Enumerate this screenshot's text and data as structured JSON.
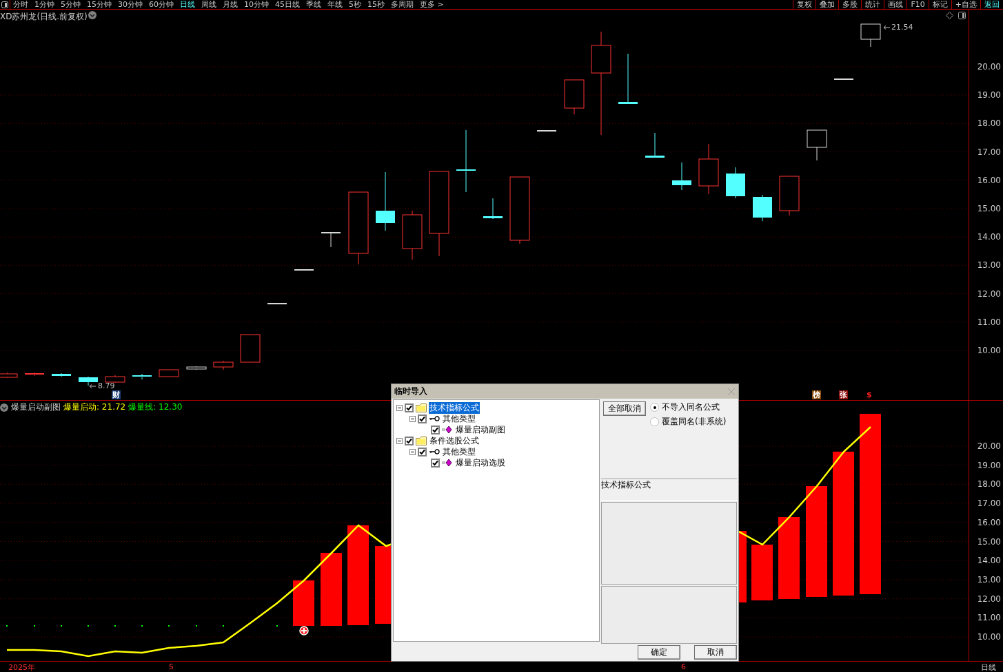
{
  "top_bar": {
    "periods": [
      {
        "label": "分时",
        "selected": false
      },
      {
        "label": "1分钟",
        "selected": false
      },
      {
        "label": "5分钟",
        "selected": false
      },
      {
        "label": "15分钟",
        "selected": false
      },
      {
        "label": "30分钟",
        "selected": false
      },
      {
        "label": "60分钟",
        "selected": false
      },
      {
        "label": "日线",
        "selected": true
      },
      {
        "label": "周线",
        "selected": false
      },
      {
        "label": "月线",
        "selected": false
      },
      {
        "label": "10分钟",
        "selected": false
      },
      {
        "label": "45日线",
        "selected": false
      },
      {
        "label": "季线",
        "selected": false
      },
      {
        "label": "年线",
        "selected": false
      },
      {
        "label": "5秒",
        "selected": false
      },
      {
        "label": "15秒",
        "selected": false
      },
      {
        "label": "多周期",
        "selected": false
      },
      {
        "label": "更多 >",
        "selected": false
      }
    ],
    "tools": [
      {
        "label": "复权",
        "selected": false
      },
      {
        "label": "叠加",
        "selected": false
      },
      {
        "label": "多股",
        "selected": false
      },
      {
        "label": "统计",
        "selected": false
      },
      {
        "label": "画线",
        "selected": false
      },
      {
        "label": "F10",
        "selected": false
      },
      {
        "label": "标记",
        "selected": false
      },
      {
        "label": "+自选",
        "selected": false
      },
      {
        "label": "返回",
        "selected": true
      }
    ]
  },
  "main_chart": {
    "title": "XD苏州龙(日线.前复权)",
    "low_label": "8.79",
    "high_label": "21.54",
    "markers": [
      {
        "label": "财",
        "kind": "tag",
        "color": "#1c3f78"
      },
      {
        "label": "榜",
        "kind": "tag",
        "color": "#8a4a08"
      },
      {
        "label": "张",
        "kind": "tag",
        "color": "#8a0a0a"
      },
      {
        "label": "$",
        "kind": "glyph",
        "color": "#ff2020"
      }
    ],
    "axis": [
      "20.00",
      "19.00",
      "18.00",
      "17.00",
      "16.00",
      "15.00",
      "14.00",
      "13.00",
      "12.00",
      "11.00",
      "10.00"
    ]
  },
  "sub_chart": {
    "title": "爆量启动副图",
    "legend": [
      {
        "label": "爆量启动: 21.72",
        "color": "#ffff00"
      },
      {
        "label": "爆量线: 12.30",
        "color": "#00ff00"
      }
    ],
    "axis": [
      "20.00",
      "19.00",
      "18.00",
      "17.00",
      "16.00",
      "15.00",
      "14.00",
      "13.00",
      "12.00",
      "11.00",
      "10.00"
    ]
  },
  "time_axis": {
    "labels": [
      "2025年",
      "5",
      "6"
    ],
    "period": "日线"
  },
  "dialog": {
    "title": "临时导入",
    "tree": [
      {
        "label": "技术指标公式",
        "kind": "folder",
        "checked": true,
        "expanded": true,
        "selected": true,
        "children": [
          {
            "label": "其他类型",
            "kind": "type",
            "checked": true,
            "expanded": true,
            "selected": false,
            "children": [
              {
                "label": "爆量启动副图",
                "kind": "formula",
                "checked": true,
                "selected": false
              }
            ]
          }
        ]
      },
      {
        "label": "条件选股公式",
        "kind": "folder",
        "checked": true,
        "expanded": true,
        "selected": false,
        "children": [
          {
            "label": "其他类型",
            "kind": "type",
            "checked": true,
            "expanded": true,
            "selected": false,
            "children": [
              {
                "label": "爆量启动选股",
                "kind": "formula",
                "checked": true,
                "selected": false
              }
            ]
          }
        ]
      }
    ],
    "clear_button": "全部取消",
    "options": [
      {
        "label": "不导入同名公式",
        "selected": true
      },
      {
        "label": "覆盖同名(非系统)",
        "selected": false
      }
    ],
    "description_label": "技术指标公式",
    "buttons": [
      "确定",
      "取消"
    ]
  }
}
